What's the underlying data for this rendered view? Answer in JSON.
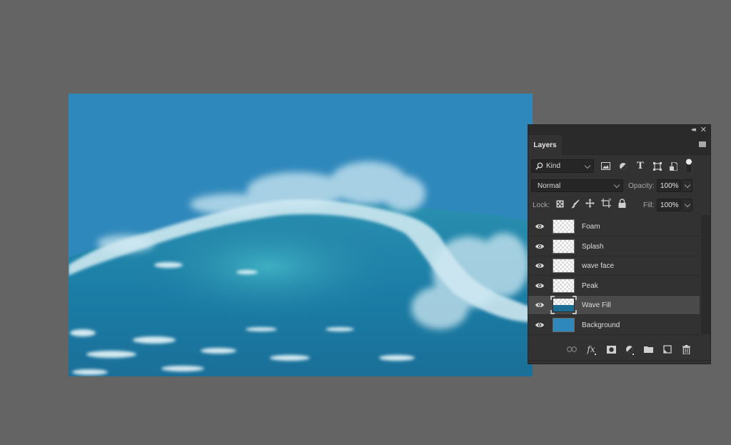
{
  "canvas": {
    "background_color": "#2f88bb",
    "content": "ocean-wave-with-splash"
  },
  "layers_panel": {
    "title_bar": {
      "collapse_icon": "double-chevron-left-icon",
      "close_icon": "close-icon",
      "collapse_glyph": "◂◂",
      "close_glyph": "✕"
    },
    "tab_label": "Layers",
    "filter": {
      "kind_label": "Kind",
      "icons": [
        "image-filter-icon",
        "adjustment-filter-icon",
        "type-filter-icon",
        "shape-filter-icon",
        "smart-object-filter-icon"
      ],
      "type_glyph": "T"
    },
    "blend_mode": "Normal",
    "opacity_label": "Opacity:",
    "opacity_value": "100%",
    "lock_label": "Lock:",
    "fill_label": "Fill:",
    "fill_value": "100%",
    "layers": [
      {
        "name": "Foam",
        "visible": true,
        "thumbnail": "transparent",
        "selected": false
      },
      {
        "name": "Splash",
        "visible": true,
        "thumbnail": "transparent",
        "selected": false
      },
      {
        "name": "wave face",
        "visible": true,
        "thumbnail": "transparent",
        "selected": false
      },
      {
        "name": "Peak",
        "visible": true,
        "thumbnail": "transparent",
        "selected": false
      },
      {
        "name": "Wave Fill",
        "visible": true,
        "thumbnail": "wave",
        "selected": true
      },
      {
        "name": "Background",
        "visible": true,
        "thumbnail": "solid-blue",
        "selected": false
      }
    ],
    "footer_icons": [
      "link-layers-icon",
      "fx-icon",
      "layer-mask-icon",
      "adjustment-layer-icon",
      "group-folder-icon",
      "new-layer-icon",
      "trash-icon"
    ],
    "fx_label": "fx",
    "colors": {
      "panel_bg": "#323232",
      "selected_row": "#4a4a4a",
      "app_bg": "#646464"
    }
  }
}
